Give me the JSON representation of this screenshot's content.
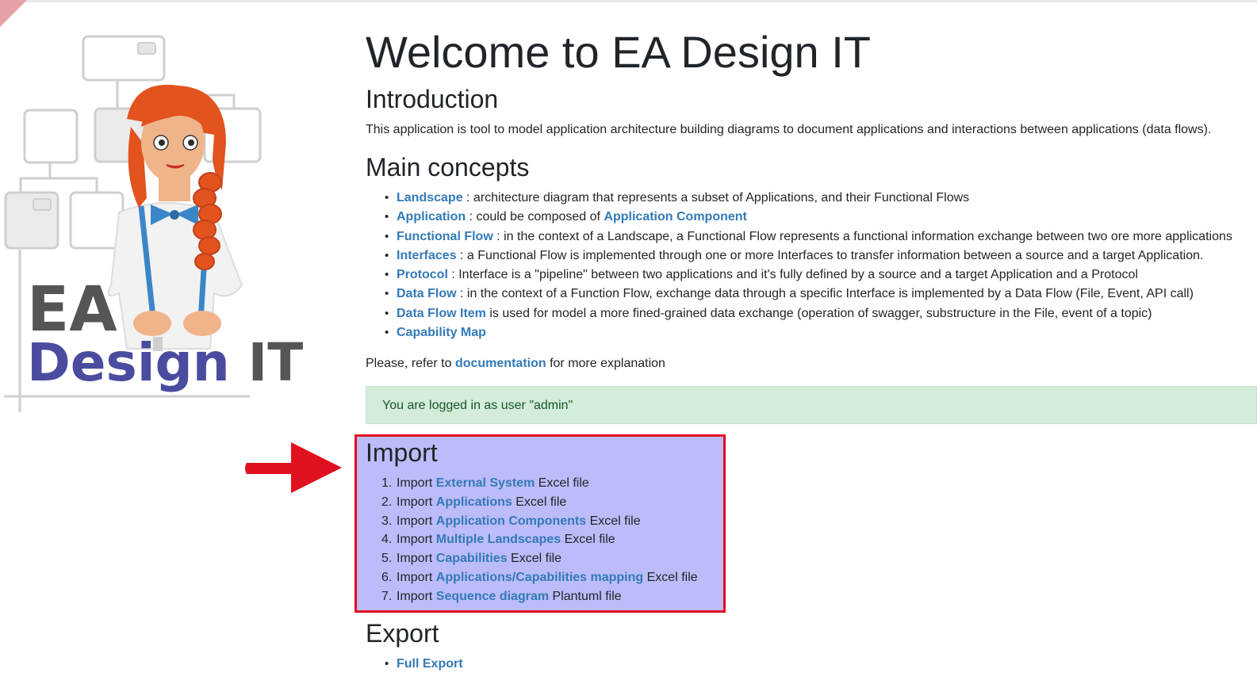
{
  "page": {
    "title": "Welcome to EA Design IT",
    "intro_heading": "Introduction",
    "intro_text": "This application is tool to model application architecture building diagrams to document applications and interactions between applications (data flows).",
    "concepts_heading": "Main concepts",
    "concepts": [
      {
        "link": "Landscape",
        "text": " : architecture diagram that represents a subset of Applications, and their Functional Flows"
      },
      {
        "link": "Application",
        "text": " : could be composed of ",
        "link2": "Application Component"
      },
      {
        "link": "Functional Flow",
        "text": " : in the context of a Landscape, a Functional Flow represents a functional information exchange between two ore more applications"
      },
      {
        "link": "Interfaces",
        "text": " : a Functional Flow is implemented through one or more Interfaces to transfer information between a source and a target Application."
      },
      {
        "link": "Protocol",
        "text": " : Interface is a \"pipeline\" between two applications and it's fully defined by a source and a target Application and a Protocol"
      },
      {
        "link": "Data Flow",
        "text": " : in the context of a Function Flow, exchange data through a specific Interface is implemented by a Data Flow (File, Event, API call)"
      },
      {
        "link": "Data Flow Item",
        "text": " is used for model a more fined-grained data exchange (operation of swagger, substructure in the File, event of a topic)"
      },
      {
        "link": "Capability Map",
        "text": ""
      }
    ],
    "refer_prefix": "Please, refer to ",
    "refer_link": "documentation",
    "refer_suffix": " for more explanation",
    "alert": "You are logged in as user \"admin\"",
    "import_heading": "Import",
    "imports": [
      {
        "num": "1.",
        "prefix": "Import ",
        "link": "External System",
        "suffix": " Excel file"
      },
      {
        "num": "2.",
        "prefix": "Import ",
        "link": "Applications",
        "suffix": " Excel file"
      },
      {
        "num": "3.",
        "prefix": "Import ",
        "link": "Application Components",
        "suffix": " Excel file"
      },
      {
        "num": "4.",
        "prefix": "Import ",
        "link": "Multiple Landscapes",
        "suffix": " Excel file"
      },
      {
        "num": "5.",
        "prefix": "Import ",
        "link": "Capabilities",
        "suffix": " Excel file"
      },
      {
        "num": "6.",
        "prefix": "Import ",
        "link": "Applications/Capabilities mapping",
        "suffix": " Excel file"
      },
      {
        "num": "7.",
        "prefix": "Import ",
        "link": "Sequence diagram",
        "suffix": " Plantuml file"
      }
    ],
    "export_heading": "Export",
    "exports": [
      {
        "link": "Full Export"
      }
    ]
  },
  "logo": {
    "line1": "EA",
    "line2a": "Design ",
    "line2b": "IT"
  },
  "colors": {
    "link": "#337ab7",
    "highlight": "#bcbcfa",
    "highlight_border": "#e0101f",
    "alert_bg": "#d4eddb",
    "arrow": "#e0101f"
  }
}
